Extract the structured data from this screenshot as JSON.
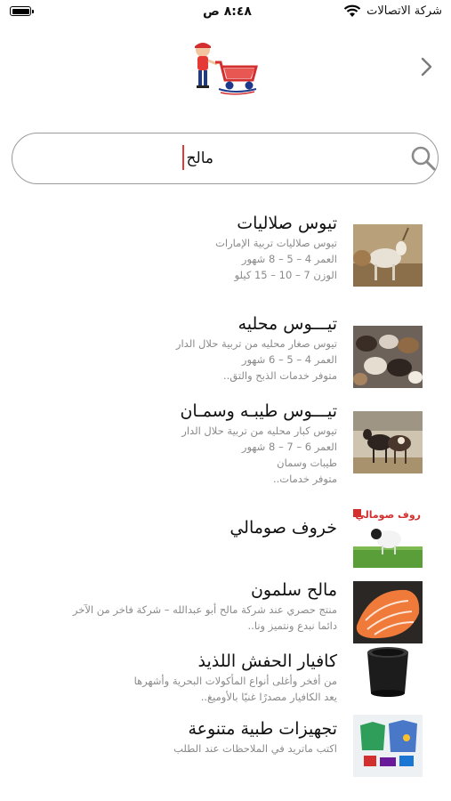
{
  "status_bar": {
    "carrier": "شركة الاتصالات",
    "time": "٨:٤٨ ص"
  },
  "search": {
    "value": "مالح"
  },
  "results": [
    {
      "title": "تيوس صلاليات",
      "lines": [
        "تيوس صلاليات تربية الإمارات",
        "العمر 4 – 5 – 8 شهور",
        "الوزن 7 – 10 – 15 كيلو"
      ]
    },
    {
      "title": "تيـــوس محليه",
      "lines": [
        "تيوس صغار محليه من تربية حلال الدار",
        "العمر 4 – 5 – 6 شهور",
        "متوفر خدمات الذبح والتق.."
      ]
    },
    {
      "title": "تيـــوس طيبـه وسمـان",
      "lines": [
        "تيوس كبار محليه من تربية حلال الدار",
        "العمر 6 – 7 – 8 شهور",
        "طيبات وسمان",
        "متوفر خدمات.."
      ]
    },
    {
      "title": "خروف صومالي",
      "lines": []
    },
    {
      "title": "مالح سلمون",
      "lines": [
        "منتج حصري عند شركة مالح أبو عبدالله  –  شركة فاخر من الآخر",
        "دائما نبدع ونتميز ونا.."
      ]
    },
    {
      "title": "كافيار الحفش اللذيذ",
      "lines": [
        "من أفخر وأغلى أنواع المأكولات البحرية وأشهرها",
        "يعد الكافيار مصدرًا غنيًا بالأوميغ.."
      ]
    },
    {
      "title": "تجهيزات طبية متنوعة",
      "lines": [
        "اكتب ماتريد في الملاحظات عند الطلب"
      ]
    }
  ],
  "thumb_banner_text": "روف صومالي",
  "colors": {
    "accent": "#e53935",
    "caret": "#e53935",
    "secondary_text": "#8a8a8a"
  },
  "icons": {
    "back": "chevron-right-icon",
    "search": "search-icon",
    "wifi": "wifi-icon",
    "battery": "battery-icon",
    "logo": "delivery-cart-logo"
  }
}
